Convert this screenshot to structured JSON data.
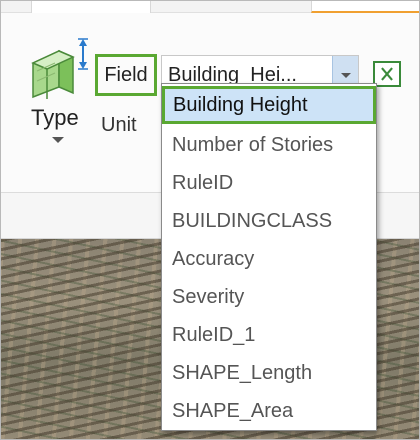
{
  "ribbon": {
    "type_label": "Type",
    "field_label": "Field",
    "unit_label": "Unit",
    "combo_value": "Building  Hei...",
    "type_icon": "building-height-icon",
    "cell_icon": "excel-cell-icon"
  },
  "dropdown": {
    "items": [
      "Building Height",
      "Number of Stories",
      "RuleID",
      "BUILDINGCLASS",
      "Accuracy",
      "Severity",
      "RuleID_1",
      "SHAPE_Length",
      "SHAPE_Area"
    ],
    "selected_index": 0
  },
  "colors": {
    "highlight_border": "#5aa832",
    "selected_bg": "#cde3f7",
    "combo_button": "#cfe0f2"
  }
}
